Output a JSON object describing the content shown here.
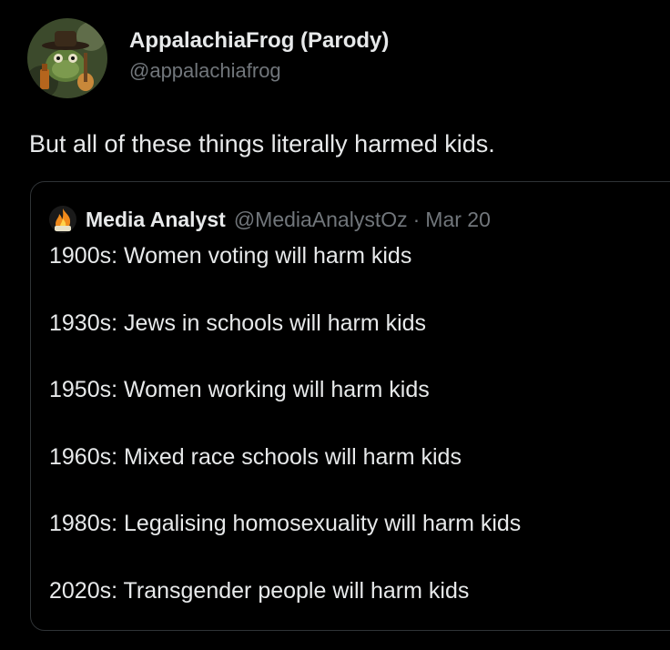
{
  "tweet": {
    "author": {
      "display_name": "AppalachiaFrog (Parody)",
      "handle": "@appalachiafrog",
      "avatar_icon": "frog-with-hat-and-banjo-avatar"
    },
    "text": "But all of these things literally harmed kids.",
    "quoted_tweet": {
      "author": {
        "display_name": "Media Analyst",
        "handle": "@MediaAnalystOz",
        "avatar_icon": "flame-avatar"
      },
      "separator": "·",
      "date": "Mar 20",
      "lines": [
        "1900s: Women voting will harm kids",
        "1930s: Jews in schools will harm kids",
        "1950s: Women working will harm kids",
        "1960s: Mixed race schools will harm kids",
        "1980s: Legalising homosexuality will harm kids",
        "2020s: Transgender people will harm kids"
      ]
    }
  },
  "colors": {
    "background": "#000000",
    "primary_text": "#e7e9ea",
    "secondary_text": "#71767b",
    "border": "#2f3336"
  }
}
